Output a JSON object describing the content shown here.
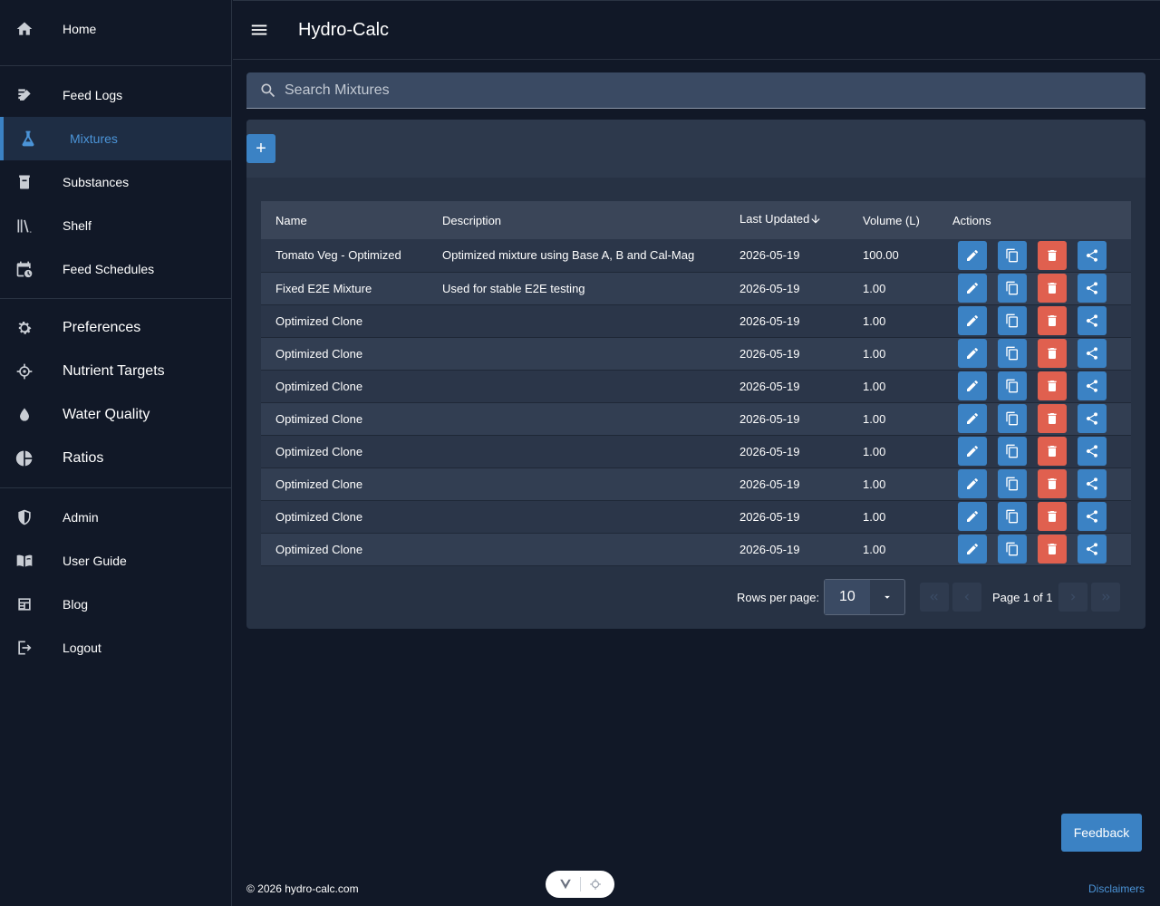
{
  "app": {
    "title": "Hydro-Calc"
  },
  "sidebar": {
    "groups": [
      {
        "items": [
          {
            "label": "Home",
            "icon": "home-icon"
          }
        ]
      },
      {
        "items": [
          {
            "label": "Feed Logs",
            "icon": "feed-logs-icon"
          },
          {
            "label": "Mixtures",
            "icon": "flask-icon",
            "active": true
          },
          {
            "label": "Substances",
            "icon": "container-icon"
          },
          {
            "label": "Shelf",
            "icon": "shelf-icon"
          },
          {
            "label": "Feed Schedules",
            "icon": "calendar-clock-icon"
          }
        ]
      },
      {
        "items": [
          {
            "label": "Preferences",
            "icon": "gear-icon"
          },
          {
            "label": "Nutrient Targets",
            "icon": "crosshair-icon"
          },
          {
            "label": "Water Quality",
            "icon": "water-drop-icon"
          },
          {
            "label": "Ratios",
            "icon": "pie-chart-icon"
          }
        ]
      },
      {
        "items": [
          {
            "label": "Admin",
            "icon": "shield-icon"
          },
          {
            "label": "User Guide",
            "icon": "book-icon"
          },
          {
            "label": "Blog",
            "icon": "newspaper-icon"
          },
          {
            "label": "Logout",
            "icon": "logout-icon"
          }
        ]
      }
    ]
  },
  "search": {
    "placeholder": "Search Mixtures"
  },
  "toolbar": {
    "add_label": "+"
  },
  "table": {
    "columns": [
      "Name",
      "Description",
      "Last Updated",
      "Volume (L)",
      "Actions"
    ],
    "sorted_column": "Last Updated",
    "rows": [
      {
        "name": "Tomato Veg - Optimized",
        "description": "Optimized mixture using Base A, B and Cal-Mag",
        "updated": "2026-05-19",
        "volume": "100.00"
      },
      {
        "name": "Fixed E2E Mixture",
        "description": "Used for stable E2E testing",
        "updated": "2026-05-19",
        "volume": "1.00"
      },
      {
        "name": "Optimized Clone",
        "description": "",
        "updated": "2026-05-19",
        "volume": "1.00"
      },
      {
        "name": "Optimized Clone",
        "description": "",
        "updated": "2026-05-19",
        "volume": "1.00"
      },
      {
        "name": "Optimized Clone",
        "description": "",
        "updated": "2026-05-19",
        "volume": "1.00"
      },
      {
        "name": "Optimized Clone",
        "description": "",
        "updated": "2026-05-19",
        "volume": "1.00"
      },
      {
        "name": "Optimized Clone",
        "description": "",
        "updated": "2026-05-19",
        "volume": "1.00"
      },
      {
        "name": "Optimized Clone",
        "description": "",
        "updated": "2026-05-19",
        "volume": "1.00"
      },
      {
        "name": "Optimized Clone",
        "description": "",
        "updated": "2026-05-19",
        "volume": "1.00"
      },
      {
        "name": "Optimized Clone",
        "description": "",
        "updated": "2026-05-19",
        "volume": "1.00"
      }
    ],
    "row_actions": [
      "edit-icon",
      "copy-icon",
      "delete-icon",
      "share-icon"
    ]
  },
  "pagination": {
    "rows_per_page_label": "Rows per page:",
    "rows_per_page": "10",
    "page_info": "Page 1 of 1"
  },
  "footer": {
    "copyright": "© 2026 hydro-calc.com",
    "disclaimers": "Disclaimers"
  },
  "feedback": {
    "label": "Feedback"
  },
  "colors": {
    "accent": "#3b82c4",
    "danger": "#e0604f",
    "background": "#111827"
  }
}
